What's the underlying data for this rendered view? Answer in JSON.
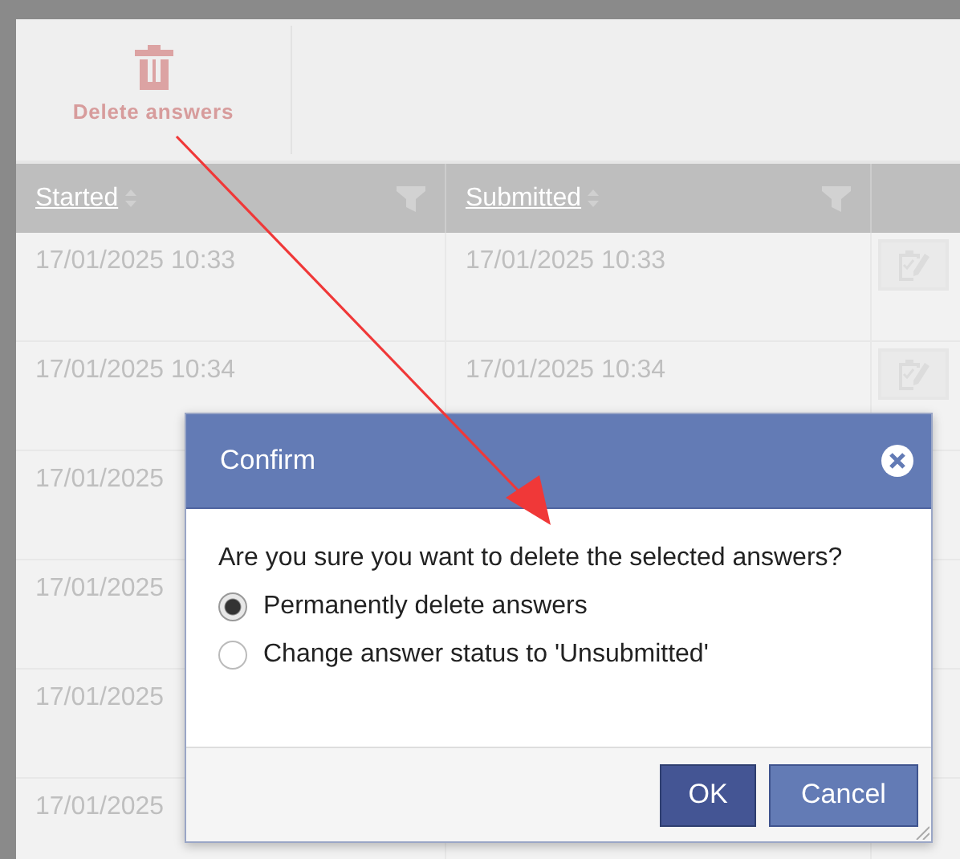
{
  "toolbar": {
    "delete_button": {
      "label": "Delete answers"
    }
  },
  "table": {
    "columns": [
      "Started",
      "Submitted"
    ],
    "rows": [
      {
        "started": "17/01/2025 10:33",
        "submitted": "17/01/2025 10:33",
        "edit_button": true
      },
      {
        "started": "17/01/2025 10:34",
        "submitted": "17/01/2025 10:34",
        "edit_button": true
      },
      {
        "started": "17/01/2025"
      },
      {
        "started": "17/01/2025"
      },
      {
        "started": "17/01/2025"
      },
      {
        "started": "17/01/2025"
      }
    ]
  },
  "dialog": {
    "title": "Confirm",
    "message": "Are you sure you want to delete the selected answers?",
    "options": [
      {
        "label": "Permanently delete answers",
        "selected": true
      },
      {
        "label": "Change answer status to 'Unsubmitted'",
        "selected": false
      }
    ],
    "buttons": [
      {
        "label": "OK",
        "kind": "primary"
      },
      {
        "label": "Cancel",
        "kind": "secondary"
      }
    ]
  }
}
